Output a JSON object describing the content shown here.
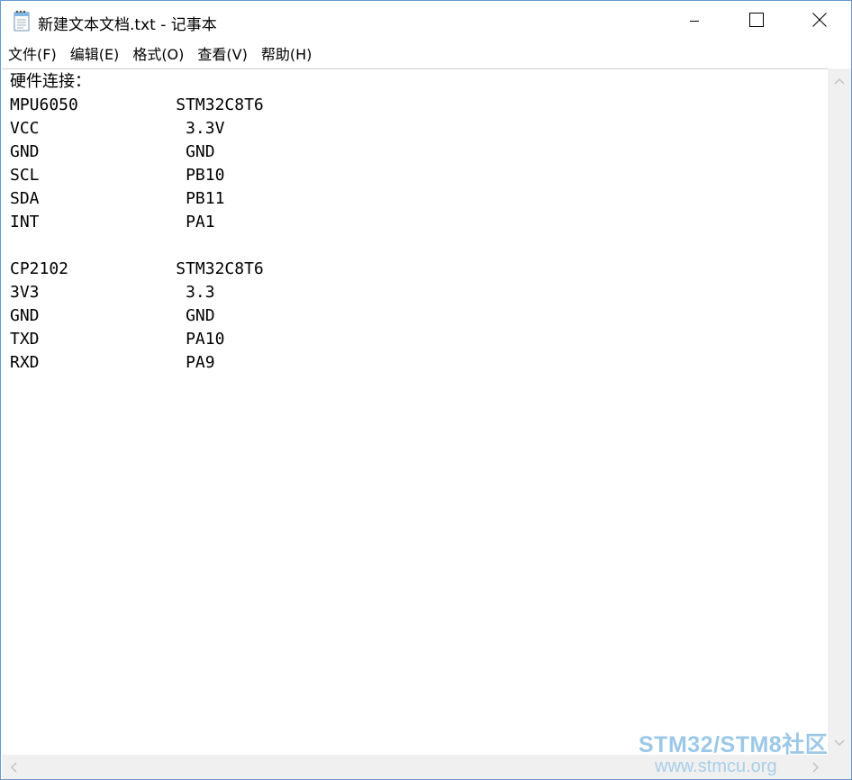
{
  "window": {
    "title": "新建文本文档.txt - 记事本",
    "icon": "notepad-icon",
    "controls": {
      "minimize_icon": "minimize-icon",
      "maximize_icon": "maximize-icon",
      "close_icon": "close-icon"
    }
  },
  "menubar": {
    "items": [
      {
        "label": "文件(F)"
      },
      {
        "label": "编辑(E)"
      },
      {
        "label": "格式(O)"
      },
      {
        "label": "查看(V)"
      },
      {
        "label": "帮助(H)"
      }
    ]
  },
  "editor": {
    "content": "硬件连接：\nMPU6050          STM32C8T6\nVCC               3.3V\nGND               GND\nSCL               PB10\nSDA               PB11\nINT               PA1\n\nCP2102           STM32C8T6\n3V3               3.3\nGND               GND\nTXD               PA10\nRXD               PA9"
  },
  "watermark": {
    "line1": "STM32/STM8社区",
    "line2": "www.stmcu.org"
  },
  "colors": {
    "window_border": "#6a97cf",
    "scrollbar_bg": "#f0f0f0",
    "watermark": "#9cc8e8"
  }
}
